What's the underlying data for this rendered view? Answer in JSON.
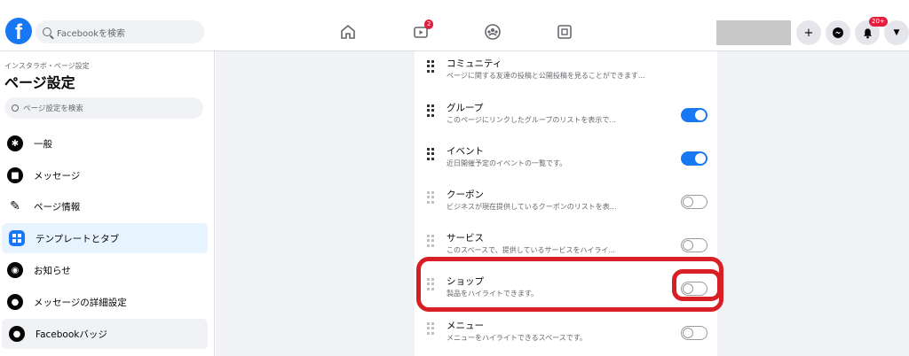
{
  "header": {
    "search_placeholder": "Facebookを検索",
    "notif_badge_watch": "2",
    "notif_badge_bell": "20+",
    "icons": [
      "home-icon",
      "watch-icon",
      "groups-icon",
      "gaming-icon",
      "plus-icon",
      "messenger-icon",
      "bell-icon",
      "caret-down-icon"
    ]
  },
  "sidebar": {
    "breadcrumb": "インスタラボ・ページ設定",
    "title": "ページ設定",
    "search_placeholder": "ページ設定を検索",
    "items": [
      {
        "label": "一般",
        "icon": "gear-icon"
      },
      {
        "label": "メッセージ",
        "icon": "chat-icon"
      },
      {
        "label": "ページ情報",
        "icon": "pencil-icon"
      },
      {
        "label": "テンプレートとタブ",
        "icon": "template-icon"
      },
      {
        "label": "お知らせ",
        "icon": "globe-icon"
      },
      {
        "label": "メッセージの詳細設定",
        "icon": "messenger-icon"
      },
      {
        "label": "Facebookバッジ",
        "icon": "badge-icon"
      }
    ]
  },
  "tabs_list": [
    {
      "title": "コミュニティ",
      "desc": "ページに関する友達の投稿と公開投稿を見ることができます...",
      "toggle": null
    },
    {
      "title": "グループ",
      "desc": "このページにリンクしたグループのリストを表示で...",
      "toggle": "on"
    },
    {
      "title": "イベント",
      "desc": "近日開催予定のイベントの一覧です。",
      "toggle": "on"
    },
    {
      "title": "クーポン",
      "desc": "ビジネスが現在提供しているクーポンのリストを表...",
      "toggle": "off"
    },
    {
      "title": "サービス",
      "desc": "このスペースで、提供しているサービスをハイライ...",
      "toggle": "off"
    },
    {
      "title": "ショップ",
      "desc": "製品をハイライトできます。",
      "toggle": "off"
    },
    {
      "title": "メニュー",
      "desc": "メニューをハイライトできるスペースです。",
      "toggle": "off"
    }
  ],
  "colors": {
    "brand": "#1877f2",
    "highlight": "#d81f26",
    "page_bg": "#f0f2f5"
  }
}
